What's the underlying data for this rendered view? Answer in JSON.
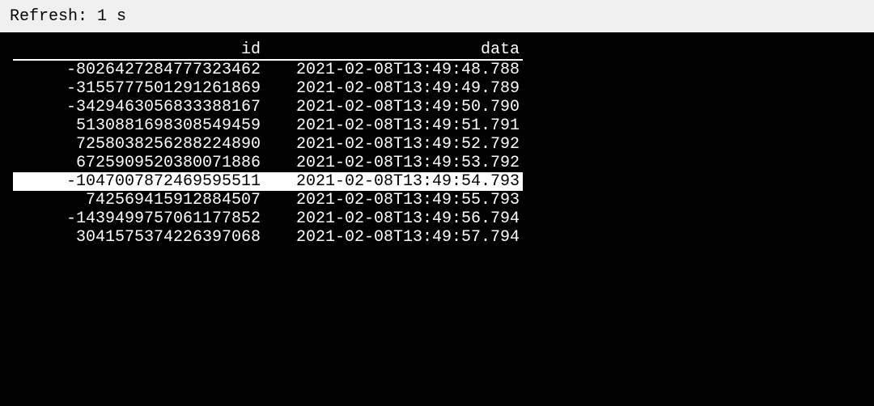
{
  "header": {
    "refresh_label": "Refresh: 1 s"
  },
  "table": {
    "columns": {
      "id": "id",
      "data": "data"
    },
    "rows": [
      {
        "id": "-8026427284777323462",
        "data": "2021-02-08T13:49:48.788",
        "highlight": false
      },
      {
        "id": "-3155777501291261869",
        "data": "2021-02-08T13:49:49.789",
        "highlight": false
      },
      {
        "id": "-3429463056833388167",
        "data": "2021-02-08T13:49:50.790",
        "highlight": false
      },
      {
        "id": "5130881698308549459",
        "data": "2021-02-08T13:49:51.791",
        "highlight": false
      },
      {
        "id": "7258038256288224890",
        "data": "2021-02-08T13:49:52.792",
        "highlight": false
      },
      {
        "id": "6725909520380071886",
        "data": "2021-02-08T13:49:53.792",
        "highlight": false
      },
      {
        "id": "-1047007872469595511",
        "data": "2021-02-08T13:49:54.793",
        "highlight": true
      },
      {
        "id": "742569415912884507",
        "data": "2021-02-08T13:49:55.793",
        "highlight": false
      },
      {
        "id": "-1439499757061177852",
        "data": "2021-02-08T13:49:56.794",
        "highlight": false
      },
      {
        "id": "3041575374226397068",
        "data": "2021-02-08T13:49:57.794",
        "highlight": false
      }
    ]
  }
}
